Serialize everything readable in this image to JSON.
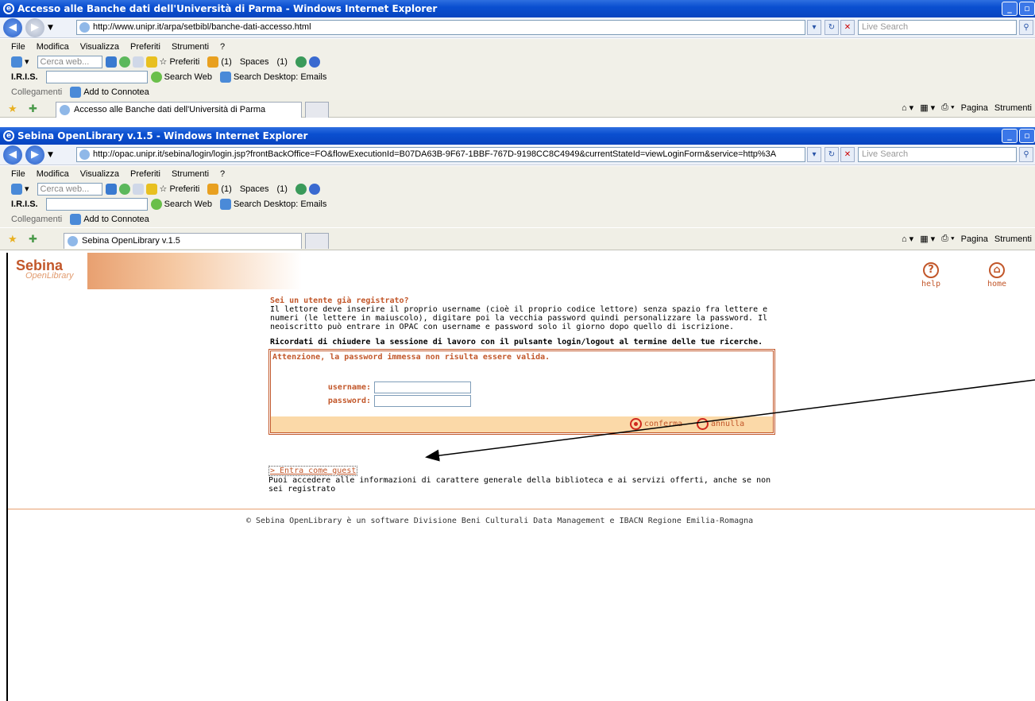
{
  "back_window": {
    "title": "Accesso alle Banche dati dell'Università di Parma - Windows Internet Explorer",
    "url": "http://www.unipr.it/arpa/setbibl/banche-dati-accesso.html",
    "live_search_placeholder": "Live Search",
    "menu": [
      "File",
      "Modifica",
      "Visualizza",
      "Preferiti",
      "Strumenti",
      "?"
    ],
    "search_placeholder": "Cerca web...",
    "toolbar_items": [
      "Preferiti",
      "(1)",
      "Spaces",
      "(1)"
    ],
    "iris_label": "I.R.I.S.",
    "search_web": "Search Web",
    "search_desktop": "Search Desktop: Emails",
    "links_label": "Collegamenti",
    "add_connotea": "Add to Connotea",
    "tab_title": "Accesso alle Banche dati dell'Università di Parma",
    "right_tools": [
      "Pagina",
      "Strumenti"
    ]
  },
  "front_window": {
    "title": "Sebina OpenLibrary v.1.5 - Windows Internet Explorer",
    "url": "http://opac.unipr.it/sebina/login/login.jsp?frontBackOffice=FO&flowExecutionId=B07DA63B-9F67-1BBF-767D-9198CC8C4949&currentStateId=viewLoginForm&service=http%3A",
    "live_search_placeholder": "Live Search",
    "menu": [
      "File",
      "Modifica",
      "Visualizza",
      "Preferiti",
      "Strumenti",
      "?"
    ],
    "search_placeholder": "Cerca web...",
    "toolbar_items": [
      "Preferiti",
      "(1)",
      "Spaces",
      "(1)"
    ],
    "iris_label": "I.R.I.S.",
    "search_web": "Search Web",
    "search_desktop": "Search Desktop: Emails",
    "links_label": "Collegamenti",
    "add_connotea": "Add to Connotea",
    "tab_title": "Sebina OpenLibrary v.1.5",
    "right_tools": [
      "Pagina",
      "Strumenti"
    ]
  },
  "page": {
    "logo_top": "Sebina",
    "logo_bottom": "OpenLibrary",
    "help_label": "help",
    "home_label": "home",
    "info_title": "Sei un utente già registrato?",
    "info_text": "Il lettore deve inserire il proprio username (cioè il proprio codice lettore) senza spazio fra lettere e numeri (le lettere in maiuscolo), digitare poi la vecchia password quindi personalizzare la password. Il neoiscritto può entrare in OPAC con username e password solo il giorno dopo quello di iscrizione.",
    "warning": "Ricordati di chiudere la sessione di lavoro con il pulsante login/logout al termine delle tue ricerche.",
    "error": "Attenzione, la password immessa non risulta essere valida.",
    "username_label": "username:",
    "password_label": "password:",
    "username_value": "",
    "password_value": "",
    "confirm_label": "conferma",
    "cancel_label": "annulla",
    "guest_link": "> Entra come guest",
    "guest_text": "Puoi accedere alle informazioni di carattere generale della biblioteca e ai servizi offerti, anche se non sei registrato",
    "footer": "© Sebina OpenLibrary è un software  Divisione Beni Culturali Data Management  e  IBACN Regione Emilia-Romagna"
  },
  "colors": {
    "accent": "#c2572a",
    "title_bar": "#0a4fd0",
    "action_bar": "#fbd9a8"
  }
}
